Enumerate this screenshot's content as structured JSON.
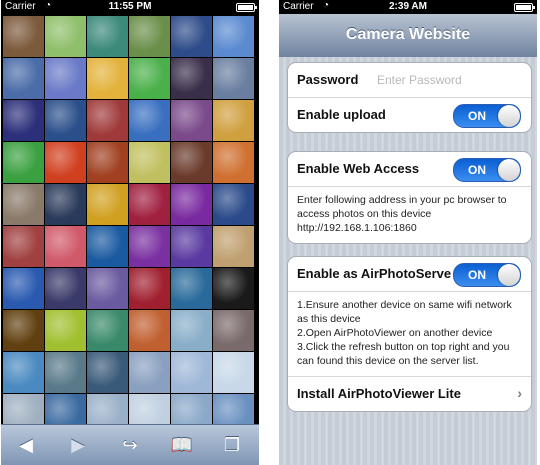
{
  "left_phone": {
    "status": {
      "carrier": "Carrier",
      "time": "11:55 PM"
    },
    "photo_grid": {
      "tiles": [
        "#7c5a3c",
        "#8fbf6a",
        "#3b8a7a",
        "#6a8f4a",
        "#2f4c8a",
        "#5a8ad0",
        "#4a6ca8",
        "#6a7ac8",
        "#e3b23a",
        "#4ab04a",
        "#3a2f4a",
        "#6a7fa0",
        "#2c2f7a",
        "#2a4f8a",
        "#a03a3a",
        "#3a6fc0",
        "#7a4a8a",
        "#d0a040",
        "#3aa040",
        "#d04020",
        "#a04020",
        "#c0c060",
        "#6a3a2a",
        "#d07030",
        "#8a7a6a",
        "#2a3a5a",
        "#d0a020",
        "#a02040",
        "#7a2aa0",
        "#2a4a8a",
        "#a04040",
        "#d05a6a",
        "#1a5aa0",
        "#7a30a0",
        "#5a3aa0",
        "#c0a070",
        "#2a5ab0",
        "#3a3a6a",
        "#6a5aa0",
        "#a02030",
        "#2a6a9a",
        "#1a1a1a",
        "#604010",
        "#a0c030",
        "#3a8a6a",
        "#c06030",
        "#8aaec8",
        "#7a6a6a",
        "#4a8ac0",
        "#5a7a8a",
        "#3a5a7a",
        "#8aa0c0",
        "#a0b8d8",
        "#c8d8e8",
        "#a0b0c0",
        "#3a6aa0",
        "#9ab0c8",
        "#c0d0e0",
        "#8aa8c8",
        "#6a90c0"
      ]
    },
    "toolbar": {
      "back": "◀",
      "forward": "▶",
      "share": "↪",
      "bookmarks": "📖",
      "tabs": "❐"
    }
  },
  "right_phone": {
    "status": {
      "carrier": "Carrier",
      "time": "2:39 AM"
    },
    "nav_title": "Camera Website",
    "password": {
      "label": "Password",
      "placeholder": "Enter Password"
    },
    "enable_upload": {
      "label": "Enable upload",
      "state": "ON"
    },
    "web_access": {
      "label": "Enable Web Access",
      "state": "ON",
      "note": "Enter following address in your pc browser to access photos on this device http://192.168.1.106:1860"
    },
    "airphoto": {
      "label": "Enable as AirPhotoServe",
      "state": "ON",
      "note_lines": [
        "1.Ensure another device on same wifi network as this device",
        "2.Open AirPhotoViewer on another device",
        "3.Click the refresh button on top right and you can found this device on the server list."
      ],
      "install_label": "Install AirPhotoViewer Lite",
      "install_chevron": "›"
    }
  }
}
